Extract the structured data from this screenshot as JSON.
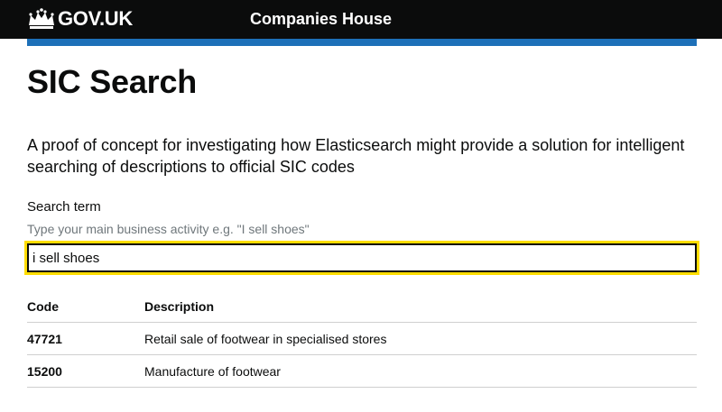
{
  "header": {
    "logo_text": "GOV.UK",
    "service_name": "Companies House"
  },
  "page": {
    "title": "SIC Search",
    "lede": "A proof of concept for investigating how Elasticsearch might provide a solution for intelligent searching of descriptions to official SIC codes"
  },
  "search": {
    "label": "Search term",
    "hint": "Type your main business activity e.g. \"I sell shoes\"",
    "value": "i sell shoes"
  },
  "results": {
    "headers": {
      "code": "Code",
      "description": "Description"
    },
    "rows": [
      {
        "code": "47721",
        "description": "Retail sale of footwear in specialised stores"
      },
      {
        "code": "15200",
        "description": "Manufacture of footwear"
      }
    ]
  },
  "colors": {
    "header_bg": "#0b0c0c",
    "accent_blue": "#1d70b8",
    "focus_yellow": "#ffdd00"
  },
  "icons": {
    "logo": "crown-icon"
  }
}
